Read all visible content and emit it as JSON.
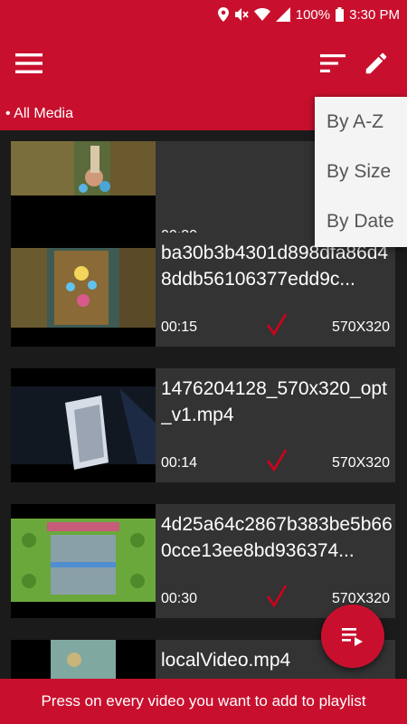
{
  "status": {
    "battery": "100%",
    "time": "3:30 PM"
  },
  "breadcrumb": "• All Media",
  "sort_menu": {
    "options": [
      "By A-Z",
      "By Size",
      "By Date"
    ]
  },
  "videos": [
    {
      "name": "",
      "duration": "00:30",
      "resolution": "",
      "selected": false
    },
    {
      "name": "ba30b3b4301d898dfa86d48ddb56106377edd9c...",
      "duration": "00:15",
      "resolution": "570X320",
      "selected": true
    },
    {
      "name": "1476204128_570x320_opt_v1.mp4",
      "duration": "00:14",
      "resolution": "570X320",
      "selected": true
    },
    {
      "name": "4d25a64c2867b383be5b660cce13ee8bd936374...",
      "duration": "00:30",
      "resolution": "570X320",
      "selected": true
    },
    {
      "name": "localVideo.mp4",
      "duration": "",
      "resolution": "",
      "selected": false
    }
  ],
  "bottom_hint": "Press on every video you want to add to playlist",
  "colors": {
    "accent": "#c8102e",
    "card": "#333333",
    "background": "#1b1b1b",
    "check": "#d0021b"
  },
  "icons": [
    "location-icon",
    "mute-icon",
    "wifi-icon",
    "signal-icon",
    "battery-icon",
    "menu-icon",
    "sort-icon",
    "edit-icon",
    "check-icon",
    "playlist-add-icon"
  ]
}
